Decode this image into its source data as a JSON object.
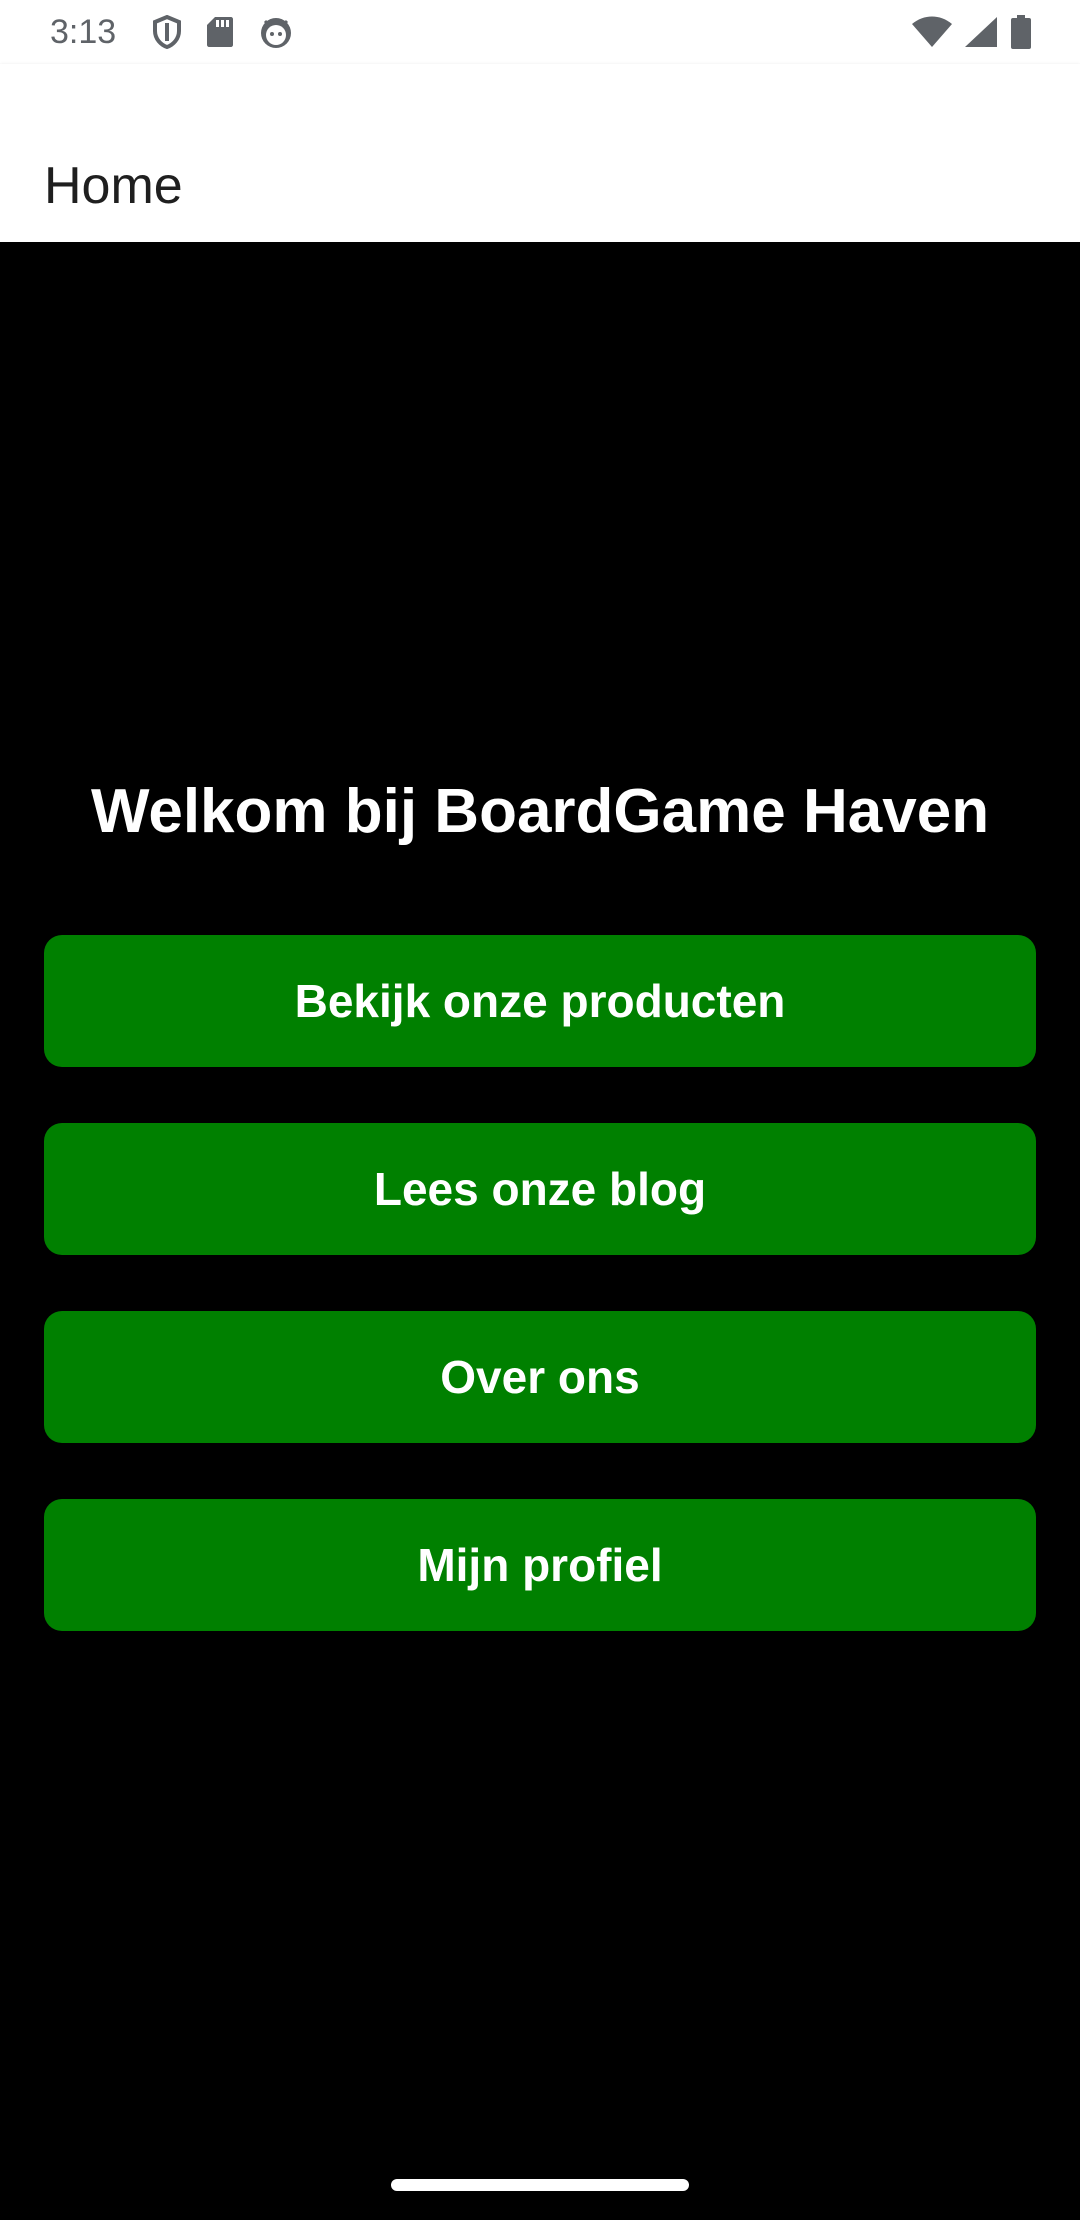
{
  "status_bar": {
    "time": "3:13",
    "left_icons": [
      "shield-icon",
      "sd-card-icon",
      "android-robot-icon"
    ],
    "right_icons": [
      "wifi-icon",
      "cellular-signal-icon",
      "battery-icon"
    ]
  },
  "app_bar": {
    "title": "Home"
  },
  "main": {
    "heading": "Welkom bij BoardGame Haven",
    "buttons": [
      {
        "label": "Bekijk onze producten"
      },
      {
        "label": "Lees onze blog"
      },
      {
        "label": "Over ons"
      },
      {
        "label": "Mijn profiel"
      }
    ]
  },
  "colors": {
    "background": "#000000",
    "button": "#008000",
    "app_bar": "#ffffff",
    "text_on_dark": "#ffffff"
  }
}
